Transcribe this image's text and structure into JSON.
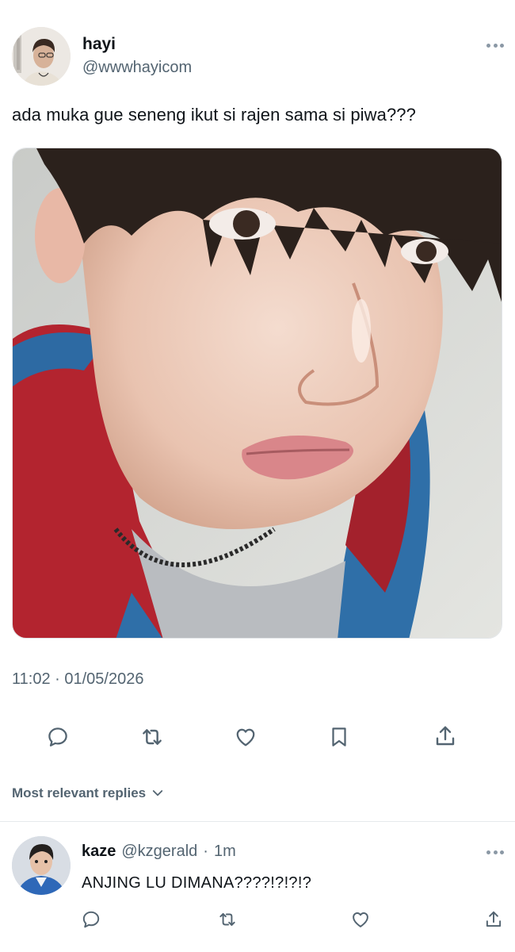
{
  "tweet": {
    "author": {
      "name": "hayi",
      "handle": "@wwwhayicom",
      "avatar_icon": "person-avatar"
    },
    "text": "ada muka gue seneng ikut si rajen sama si piwa???",
    "media": {
      "icon": "photo-selfie"
    },
    "timestamp": "11:02 · 01/05/2026",
    "actions": [
      {
        "name": "reply",
        "icon": "speech-bubble-icon"
      },
      {
        "name": "retweet",
        "icon": "retweet-icon"
      },
      {
        "name": "like",
        "icon": "heart-icon"
      },
      {
        "name": "bookmark",
        "icon": "bookmark-icon"
      },
      {
        "name": "share",
        "icon": "share-icon"
      }
    ]
  },
  "replies_sort": {
    "label": "Most relevant replies",
    "icon": "chevron-down-icon"
  },
  "reply": {
    "name": "kaze",
    "handle": "@kzgerald",
    "separator": "·",
    "time": "1m",
    "text": "ANJING LU DIMANA????!?!?!?",
    "avatar_icon": "person-avatar"
  },
  "colors": {
    "text_primary": "#0f1419",
    "text_secondary": "#536471",
    "icon_gray": "#536471",
    "divider": "#e6e9ec"
  }
}
